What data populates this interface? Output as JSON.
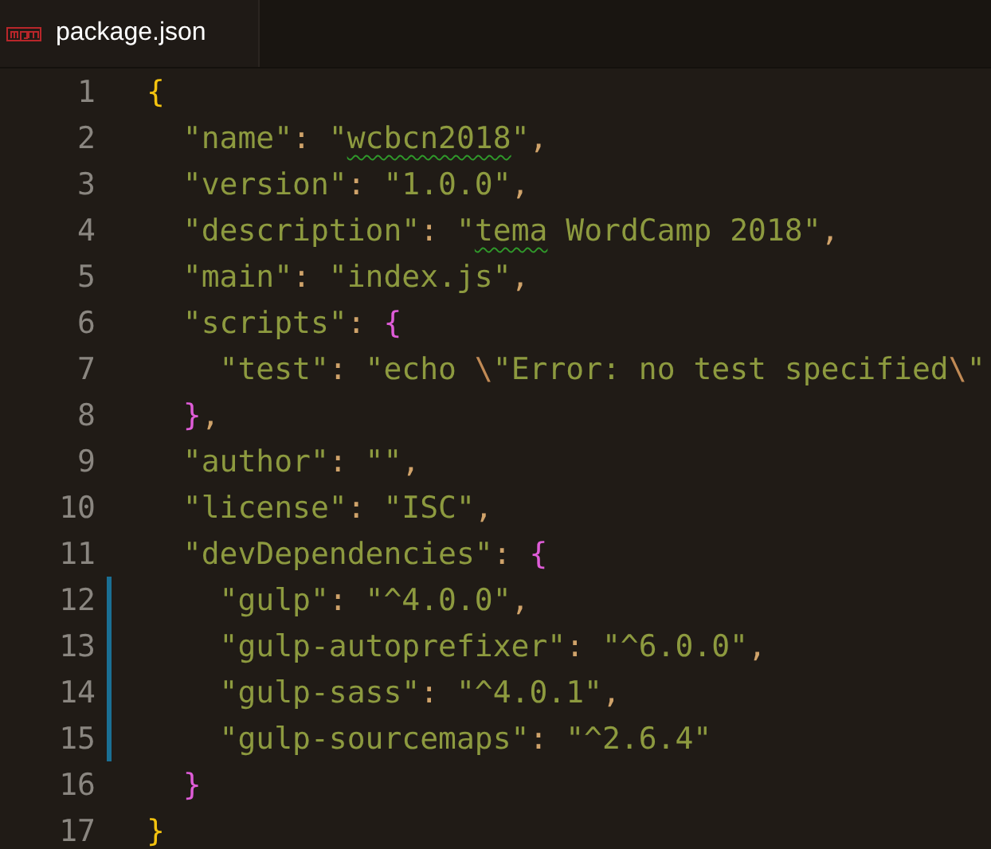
{
  "tab": {
    "label": "package.json",
    "selected": true
  },
  "lines": [
    {
      "number": "1",
      "modified": false,
      "tokens": [
        {
          "kind": "brace-outer",
          "text": "{"
        }
      ],
      "children": [
        {
          "number": "2",
          "modified": false,
          "tokens": [
            {
              "kind": "key",
              "text": "\"name\""
            },
            {
              "kind": "punct",
              "text": ": "
            },
            {
              "kind": "str",
              "text": "\""
            },
            {
              "kind": "typo",
              "text": "wcbcn2018"
            },
            {
              "kind": "str",
              "text": "\""
            },
            {
              "kind": "punct",
              "text": ","
            }
          ]
        },
        {
          "number": "3",
          "modified": false,
          "tokens": [
            {
              "kind": "key",
              "text": "\"version\""
            },
            {
              "kind": "punct",
              "text": ": "
            },
            {
              "kind": "str",
              "text": "\"1.0.0\""
            },
            {
              "kind": "punct",
              "text": ","
            }
          ]
        },
        {
          "number": "4",
          "modified": false,
          "tokens": [
            {
              "kind": "key",
              "text": "\"description\""
            },
            {
              "kind": "punct",
              "text": ": "
            },
            {
              "kind": "str",
              "text": "\""
            },
            {
              "kind": "typo",
              "text": "tema"
            },
            {
              "kind": "str",
              "text": " WordCamp 2018\""
            },
            {
              "kind": "punct",
              "text": ","
            }
          ]
        },
        {
          "number": "5",
          "modified": false,
          "tokens": [
            {
              "kind": "key",
              "text": "\"main\""
            },
            {
              "kind": "punct",
              "text": ": "
            },
            {
              "kind": "str",
              "text": "\"index.js\""
            },
            {
              "kind": "punct",
              "text": ","
            }
          ]
        },
        {
          "number": "6",
          "modified": false,
          "tokens": [
            {
              "kind": "key",
              "text": "\"scripts\""
            },
            {
              "kind": "punct",
              "text": ": "
            },
            {
              "kind": "brace-inner",
              "text": "{"
            }
          ],
          "children": [
            {
              "number": "7",
              "modified": false,
              "tokens": [
                {
                  "kind": "key",
                  "text": "\"test\""
                },
                {
                  "kind": "punct",
                  "text": ": "
                },
                {
                  "kind": "str",
                  "text": "\"echo "
                },
                {
                  "kind": "esc",
                  "text": "\\"
                },
                {
                  "kind": "str",
                  "text": "\"Error: no test specified"
                },
                {
                  "kind": "esc",
                  "text": "\\"
                },
                {
                  "kind": "str",
                  "text": "\""
                }
              ]
            }
          ]
        },
        {
          "number": "8",
          "modified": false,
          "tokens": [
            {
              "kind": "brace-inner",
              "text": "}"
            },
            {
              "kind": "punct",
              "text": ","
            }
          ]
        },
        {
          "number": "9",
          "modified": false,
          "tokens": [
            {
              "kind": "key",
              "text": "\"author\""
            },
            {
              "kind": "punct",
              "text": ": "
            },
            {
              "kind": "str",
              "text": "\"\""
            },
            {
              "kind": "punct",
              "text": ","
            }
          ]
        },
        {
          "number": "10",
          "modified": false,
          "tokens": [
            {
              "kind": "key",
              "text": "\"license\""
            },
            {
              "kind": "punct",
              "text": ": "
            },
            {
              "kind": "str",
              "text": "\"ISC\""
            },
            {
              "kind": "punct",
              "text": ","
            }
          ]
        },
        {
          "number": "11",
          "modified": false,
          "tokens": [
            {
              "kind": "key",
              "text": "\"devDependencies\""
            },
            {
              "kind": "punct",
              "text": ": "
            },
            {
              "kind": "brace-inner",
              "text": "{"
            }
          ],
          "children": [
            {
              "number": "12",
              "modified": true,
              "tokens": [
                {
                  "kind": "key",
                  "text": "\"gulp\""
                },
                {
                  "kind": "punct",
                  "text": ": "
                },
                {
                  "kind": "str",
                  "text": "\"^4.0.0\""
                },
                {
                  "kind": "punct",
                  "text": ","
                }
              ]
            },
            {
              "number": "13",
              "modified": true,
              "tokens": [
                {
                  "kind": "key",
                  "text": "\"gulp-autoprefixer\""
                },
                {
                  "kind": "punct",
                  "text": ": "
                },
                {
                  "kind": "str",
                  "text": "\"^6.0.0\""
                },
                {
                  "kind": "punct",
                  "text": ","
                }
              ]
            },
            {
              "number": "14",
              "modified": true,
              "tokens": [
                {
                  "kind": "key",
                  "text": "\"gulp-sass\""
                },
                {
                  "kind": "punct",
                  "text": ": "
                },
                {
                  "kind": "str",
                  "text": "\"^4.0.1\""
                },
                {
                  "kind": "punct",
                  "text": ","
                }
              ]
            },
            {
              "number": "15",
              "modified": true,
              "tokens": [
                {
                  "kind": "key",
                  "text": "\"gulp-sourcemaps\""
                },
                {
                  "kind": "punct",
                  "text": ": "
                },
                {
                  "kind": "str",
                  "text": "\"^2.6.4\""
                }
              ]
            }
          ]
        },
        {
          "number": "16",
          "modified": false,
          "tokens": [
            {
              "kind": "brace-inner",
              "text": "}"
            }
          ]
        }
      ]
    },
    {
      "number": "17",
      "modified": false,
      "tokens": [
        {
          "kind": "brace-outer",
          "text": "}"
        }
      ]
    }
  ]
}
